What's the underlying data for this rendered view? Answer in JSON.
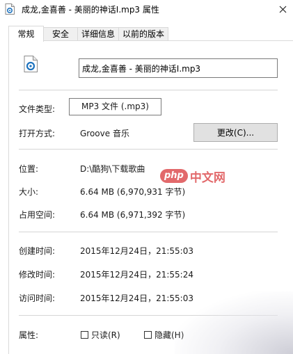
{
  "window": {
    "title": "成龙,金喜善 - 美丽的神话Ⅰ.mp3 属性",
    "close_label": "✕"
  },
  "tabs": [
    {
      "label": "常规",
      "active": true
    },
    {
      "label": "安全",
      "active": false
    },
    {
      "label": "详细信息",
      "active": false
    },
    {
      "label": "以前的版本",
      "active": false
    }
  ],
  "general": {
    "file_name": "成龙,金喜善 - 美丽的神话Ⅰ.mp3",
    "file_type_label": "文件类型:",
    "file_type_value": "MP3 文件 (.mp3)",
    "open_with_label": "打开方式:",
    "open_with_value": "Groove 音乐",
    "change_button": "更改(C)...",
    "location_label": "位置:",
    "location_value": "D:\\酷狗\\下载歌曲",
    "size_label": "大小:",
    "size_value": "6.64 MB (6,970,931 字节)",
    "disk_size_label": "占用空间:",
    "disk_size_value": "6.64 MB (6,971,392 字节)",
    "created_label": "创建时间:",
    "created_value": "2015年12月24日，21:55:03",
    "modified_label": "修改时间:",
    "modified_value": "2015年12月24日，21:55:24",
    "accessed_label": "访问时间:",
    "accessed_value": "2015年12月24日，21:55:03",
    "attributes_label": "属性:",
    "readonly_label": "只读(R)",
    "readonly_checked": false,
    "hidden_label": "隐藏(H)",
    "hidden_checked": false
  },
  "watermark": {
    "logo_text": "php",
    "site_text": "中文网"
  },
  "icons": {
    "title_icon": "audio-file-icon",
    "file_icon": "audio-file-icon",
    "close_icon": "close-icon",
    "accent_color": "#1e73be"
  }
}
